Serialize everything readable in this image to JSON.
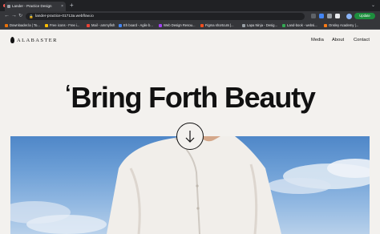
{
  "browser": {
    "tab_title": "Lander - Practice Design",
    "url": "lander-practice-01713a.webflow.io",
    "update_label": "Update",
    "traffic_colors": [
      "#ff5f57",
      "#febc2e",
      "#28c840"
    ],
    "bookmarks": [
      {
        "label": "Downloader.la | To...",
        "color": "#e8710a"
      },
      {
        "label": "Free icons - Free i...",
        "color": "#fbbc04"
      },
      {
        "label": "Mail - ammyfish",
        "color": "#ea4335"
      },
      {
        "label": "Eh board - Agile b...",
        "color": "#4285f4"
      },
      {
        "label": "Web Design Resou...",
        "color": "#a142f4"
      },
      {
        "label": "Figma shortcuts |...",
        "color": "#f24e1e"
      },
      {
        "label": "Lapa Ninja - Desig...",
        "color": "#9aa0a6"
      },
      {
        "label": "Land-book - websi...",
        "color": "#34a853"
      },
      {
        "label": "Onsley Academy |...",
        "color": "#fa7b17"
      }
    ]
  },
  "site": {
    "logo": "ALABASTER",
    "nav": {
      "media": "Media",
      "about": "About",
      "contact": "Contact"
    },
    "headline_quote": "‘",
    "headline": "Bring Forth Beauty"
  },
  "icons": {
    "scroll": "arrow-down-icon",
    "logo": "drop-icon"
  }
}
